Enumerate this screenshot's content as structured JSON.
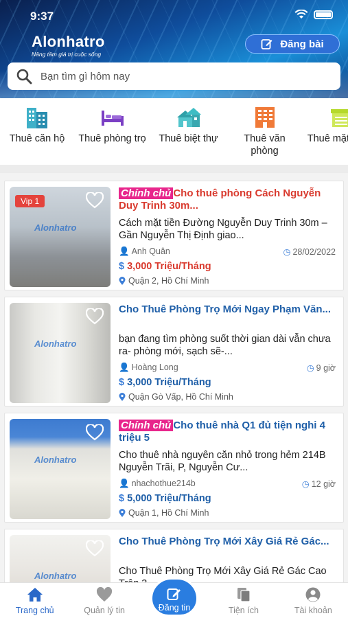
{
  "status_bar": {
    "time": "9:37"
  },
  "header": {
    "logo_title": "Alonhatro",
    "logo_slogan": "Nâng tầm giá trị cuộc sống",
    "post_button_label": "Đăng bài",
    "search_placeholder": "Bạn tìm gì hôm nay"
  },
  "categories": [
    {
      "label": "Thuê căn hộ",
      "icon": "apartment-icon"
    },
    {
      "label": "Thuê phòng trọ",
      "icon": "bed-icon"
    },
    {
      "label": "Thuê biệt thự",
      "icon": "villa-icon"
    },
    {
      "label": "Thuê văn phòng",
      "icon": "office-icon"
    },
    {
      "label": "Thuê mặt bằng",
      "icon": "shop-icon"
    }
  ],
  "listings": [
    {
      "vip": "Vip 1",
      "owner_tag": "Chính chủ",
      "title": "Cho thuê phòng Cách Nguyễn Duy Trinh 30m...",
      "description": "Cách mặt tiền Đường Nguyễn Duy Trinh 30m – Gần Nguyễn Thị Định giao...",
      "author": "Anh Quân",
      "time": "28/02/2022",
      "price": "3,000 Triệu/Tháng",
      "currency": "$",
      "location": "Quận 2, Hồ Chí Minh",
      "watermark": "Alonhatro"
    },
    {
      "owner_tag": "",
      "title": "Cho Thuê Phòng Trọ Mới Ngay Phạm Văn...",
      "description": "bạn đang tìm phòng suốt thời gian dài vẫn chưa ra- phòng mới, sạch sẽ-...",
      "author": "Hoàng Long",
      "time": "9 giờ",
      "price": "3,000 Triệu/Tháng",
      "currency": "$",
      "location": "Quận Gò Vấp, Hồ Chí Minh",
      "watermark": "Alonhatro"
    },
    {
      "owner_tag": "Chính chủ",
      "title": "Cho thuê nhà Q1 đủ tiện nghi 4 triệu 5",
      "description": "Cho thuê nhà nguyên căn nhỏ trong hẻm 214B Nguyễn Trãi, P, Nguyễn Cư...",
      "author": "nhachothue214b",
      "time": "12 giờ",
      "price": "5,000 Triệu/Tháng",
      "currency": "$",
      "location": "Quận 1, Hồ Chí Minh",
      "watermark": "Alonhatro"
    },
    {
      "owner_tag": "",
      "title": "Cho Thuê Phòng Trọ Mới Xây Giá Rẻ Gác...",
      "description": "Cho Thuê Phòng Trọ Mới Xây Giá Rẻ Gác Cao Trên 3...",
      "author": "",
      "time": "",
      "price": "",
      "currency": "",
      "location": "",
      "watermark": "Alonhatro"
    }
  ],
  "bottom_nav": [
    {
      "label": "Trang chủ",
      "active": true
    },
    {
      "label": "Quản lý tin",
      "active": false
    },
    {
      "label": "Đăng tin",
      "active": false
    },
    {
      "label": "Tiện ích",
      "active": false
    },
    {
      "label": "Tài khoản",
      "active": false
    }
  ],
  "colors": {
    "primary": "#2a68c8",
    "title_blue": "#1f5fa8",
    "vip_red": "#d93a2e",
    "owner_tag_pink": "#e8268c"
  }
}
